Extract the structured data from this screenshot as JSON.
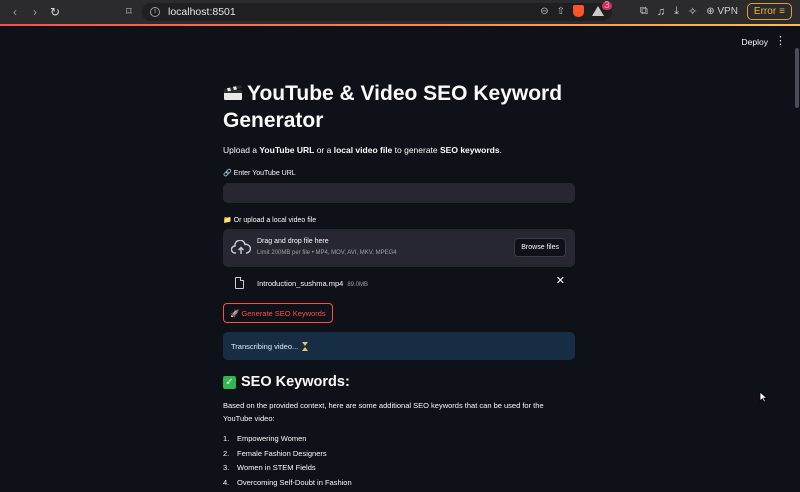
{
  "browser": {
    "url": "localhost:8501",
    "vpn_label": "VPN",
    "error_label": "Error",
    "notification_count": "3"
  },
  "header": {
    "deploy_label": "Deploy"
  },
  "app": {
    "title": "YouTube & Video SEO Keyword Generator",
    "subtitle_parts": {
      "p1": "Upload a ",
      "b1": "YouTube URL",
      "p2": " or a ",
      "b2": "local video file",
      "p3": " to generate ",
      "b3": "SEO keywords",
      "p4": "."
    },
    "url_input": {
      "label": "🔗 Enter YouTube URL",
      "value": ""
    },
    "upload": {
      "label": "📁 Or upload a local video file",
      "drop_title": "Drag and drop file here",
      "limit_text": "Limit 200MB per file • MP4, MOV, AVI, MKV, MPEG4",
      "browse_label": "Browse files",
      "file_name": "Introduction_sushma.mp4",
      "file_size": "89.0MB"
    },
    "generate_label": "🚀 Generate SEO Keywords",
    "status_text": "Transcribing video...",
    "keywords_heading": "SEO Keywords:",
    "intro_paragraph": "Based on the provided context, here are some additional SEO keywords that can be used for the YouTube video:",
    "keywords": [
      {
        "num": "1.",
        "text": "Empowering Women"
      },
      {
        "num": "2.",
        "text": "Female Fashion Designers"
      },
      {
        "num": "3.",
        "text": "Women in STEM Fields"
      },
      {
        "num": "4.",
        "text": "Overcoming Self-Doubt in Fashion"
      }
    ]
  },
  "colors": {
    "background": "#0e1117",
    "accent": "#ff4b4b",
    "input_bg": "#262730",
    "info_bg": "#172d43",
    "success": "#2eb84f"
  }
}
